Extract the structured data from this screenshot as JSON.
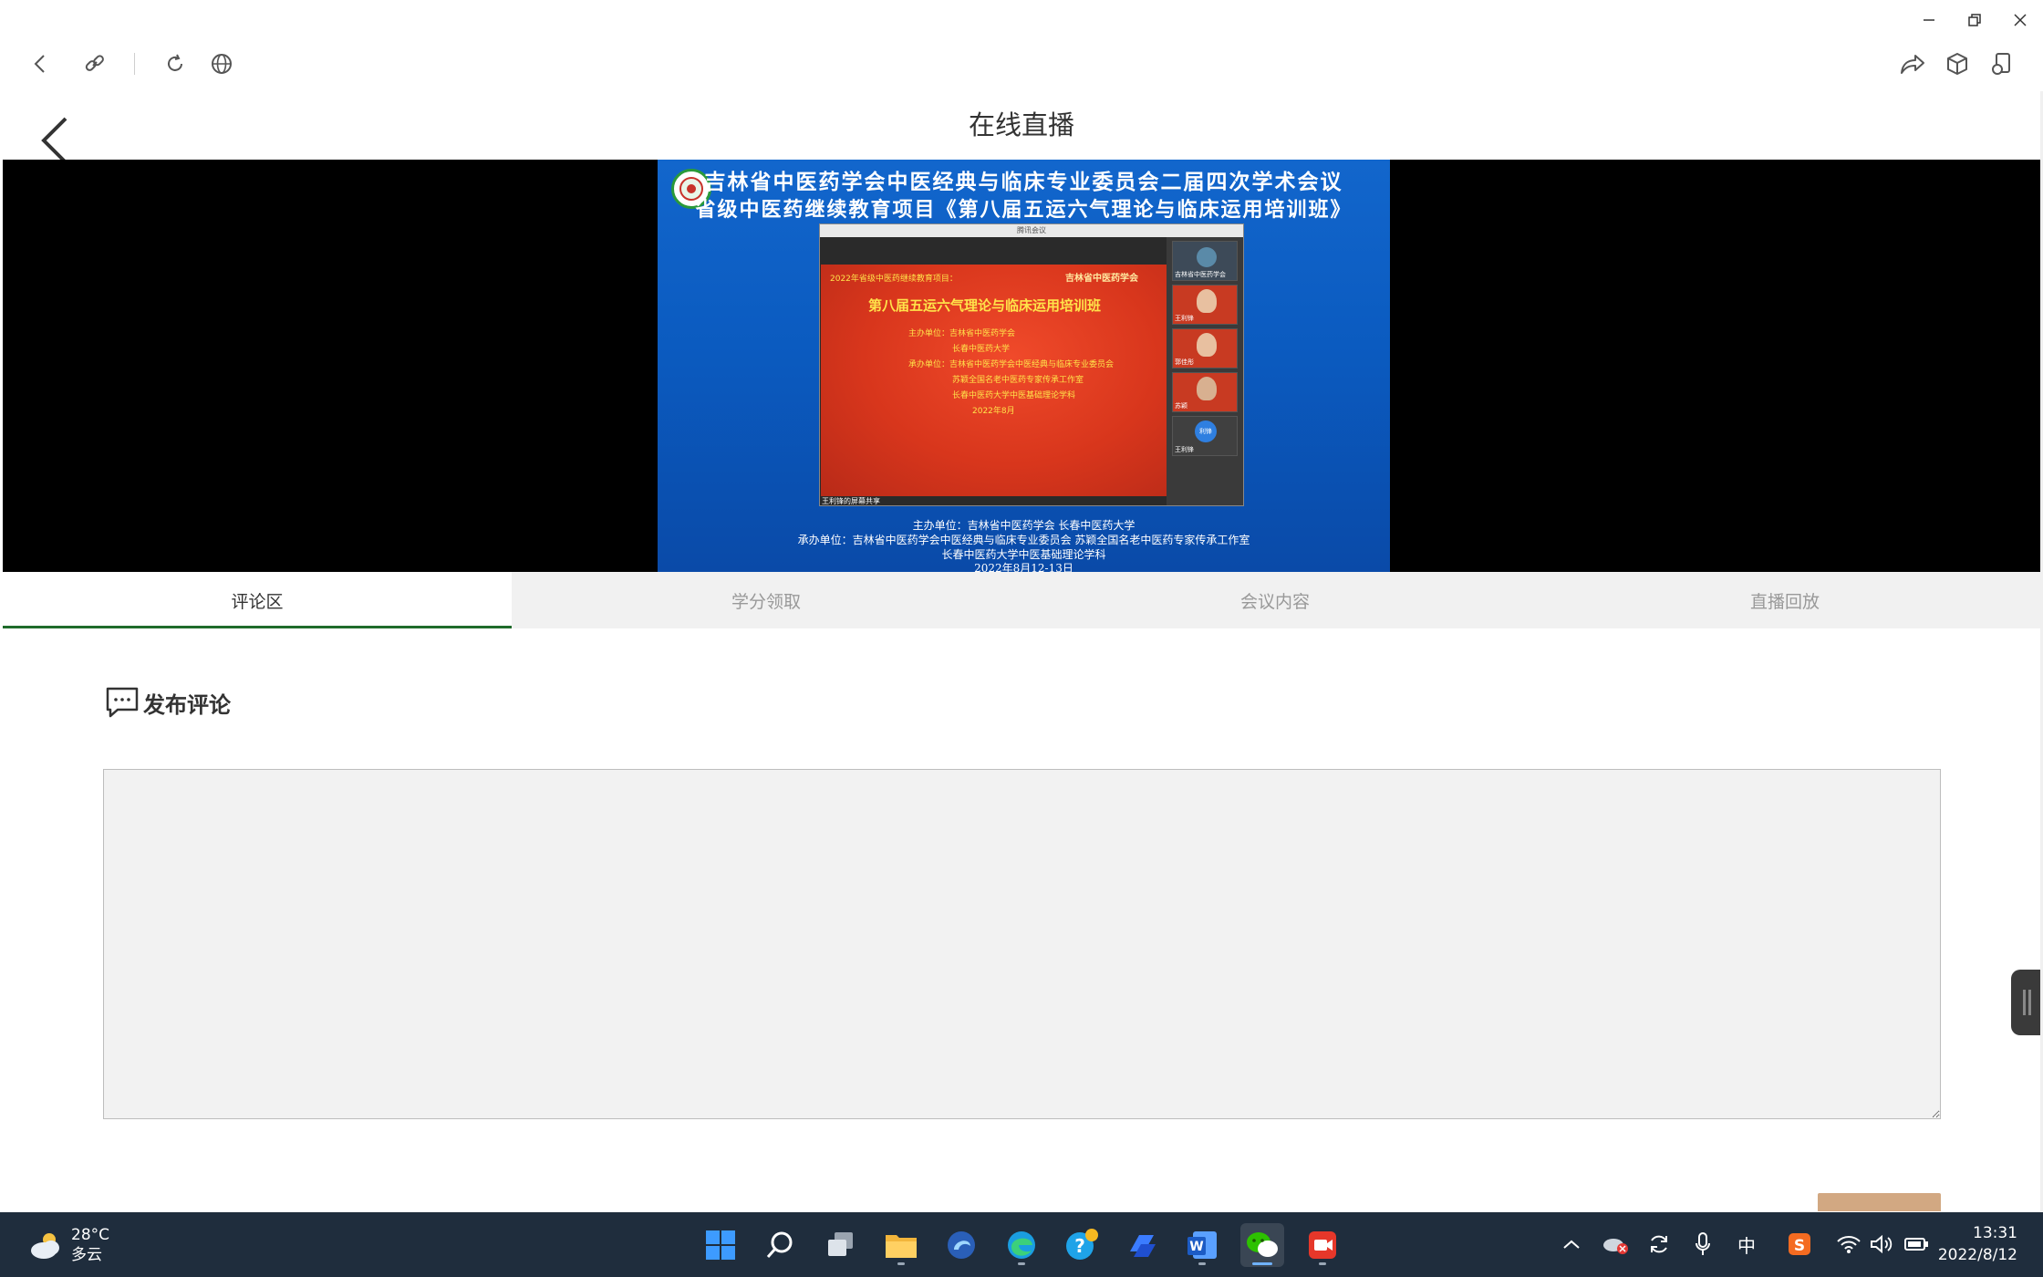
{
  "page": {
    "title": "在线直播"
  },
  "video": {
    "slide_title_line1": "吉林省中医药学会中医经典与临床专业委员会二届四次学术会议",
    "slide_title_line2": "省级中医药继续教育项目《第八届五运六气理论与临床运用培训班》",
    "inner_window_title": "腾讯会议",
    "inner_slide": {
      "project_note": "2022年省级中医药继续教育项目：",
      "org_logo_text": "吉林省中医药学会",
      "heading": "第八届五运六气理论与临床运用培训班",
      "host_label": "主办单位：吉林省中医药学会",
      "host_2": "长春中医药大学",
      "undertaker_label": "承办单位：吉林省中医药学会中医经典与临床专业委员会",
      "undertaker_2": "苏颖全国名老中医药专家传承工作室",
      "undertaker_3": "长春中医药大学中医基础理论学科",
      "date": "2022年8月"
    },
    "participants": [
      {
        "name": "吉林省中医药学会"
      },
      {
        "name": "王利锋"
      },
      {
        "name": "郭佳彤"
      },
      {
        "name": "苏颖"
      },
      {
        "name": "王利锋"
      }
    ],
    "avatar_initials": "利锋",
    "screen_share_label": "王利锋的屏幕共享",
    "footer_line1": "主办单位：吉林省中医药学会  长春中医药大学",
    "footer_line2": "承办单位：吉林省中医药学会中医经典与临床专业委员会  苏颖全国名老中医药专家传承工作室",
    "footer_line3": "长春中医药大学中医基础理论学科",
    "footer_line4": "2022年8月12-13日"
  },
  "tabs": [
    {
      "label": "评论区",
      "active": true
    },
    {
      "label": "学分领取",
      "active": false
    },
    {
      "label": "会议内容",
      "active": false
    },
    {
      "label": "直播回放",
      "active": false
    }
  ],
  "comment": {
    "title": "发布评论",
    "value": ""
  },
  "taskbar": {
    "weather": {
      "temp": "28°C",
      "condition": "多云"
    },
    "ime": "中",
    "time": "13:31",
    "date": "2022/8/12"
  },
  "colors": {
    "accent": "#1f6b2b",
    "slide_blue": "#0b5bc0",
    "slide_red": "#d8361c",
    "submit": "#d2a882",
    "taskbar": "#1f2d3d"
  }
}
